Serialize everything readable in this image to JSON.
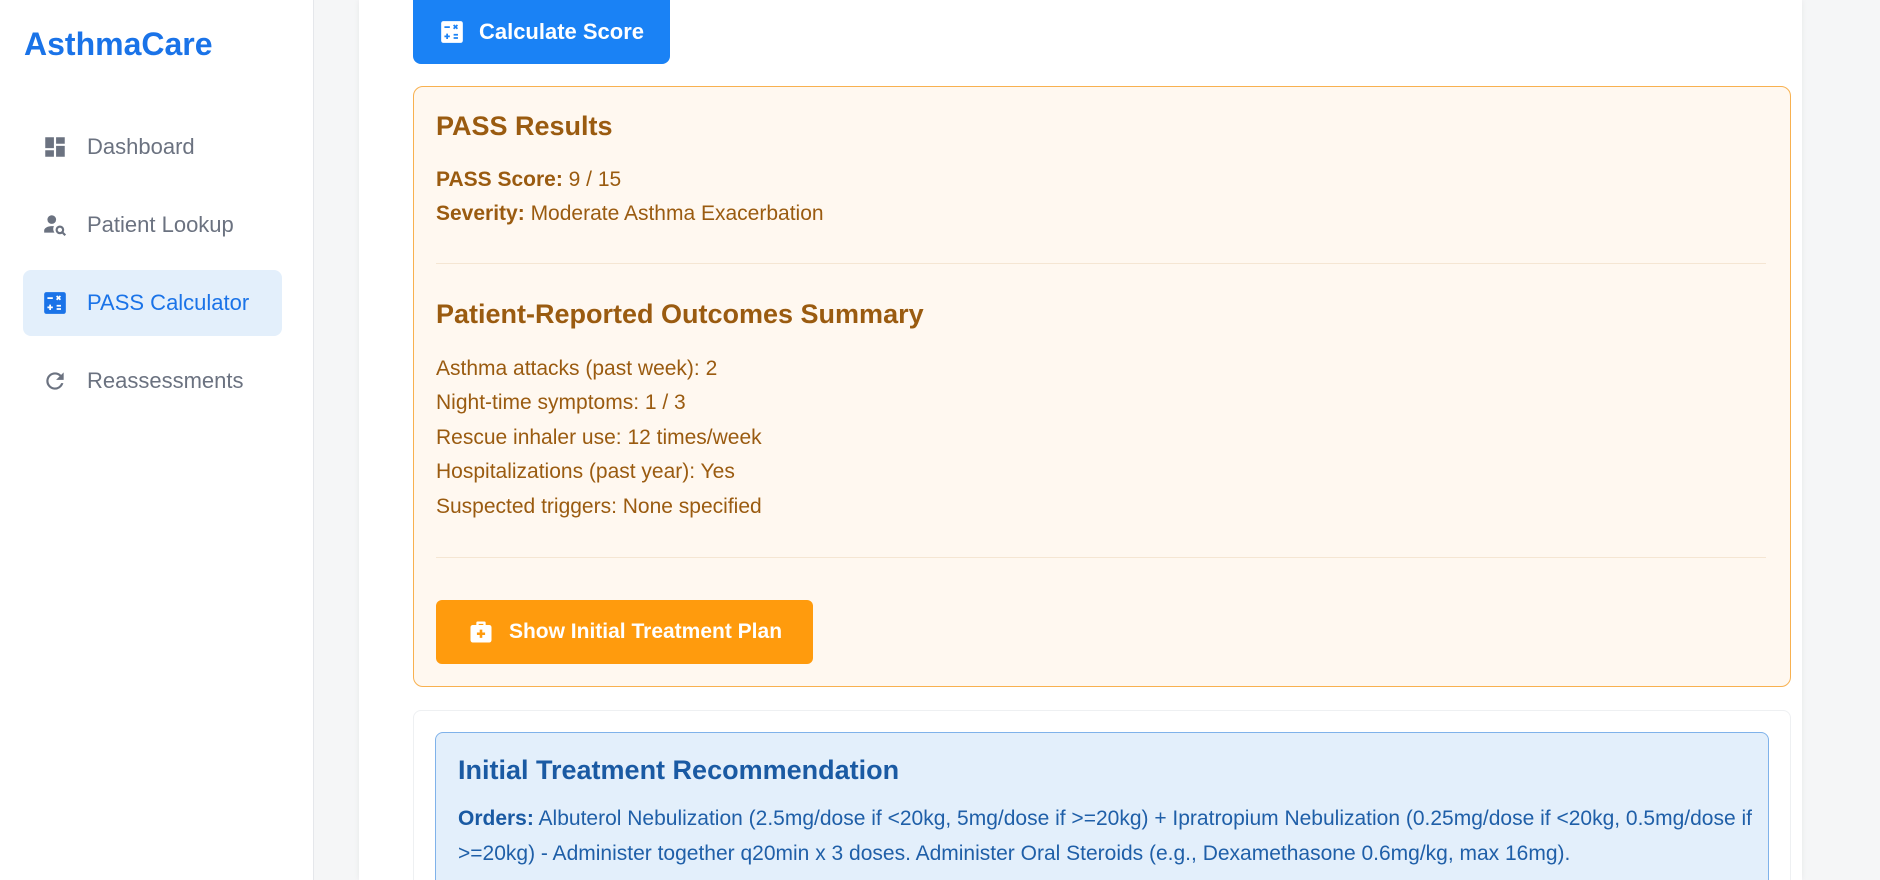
{
  "sidebar": {
    "brand": "AsthmaCare",
    "items": [
      {
        "label": "Dashboard",
        "icon": "dashboard-icon",
        "active": false
      },
      {
        "label": "Patient Lookup",
        "icon": "person-search-icon",
        "active": false
      },
      {
        "label": "PASS Calculator",
        "icon": "calculator-icon",
        "active": true
      },
      {
        "label": "Reassessments",
        "icon": "refresh-icon",
        "active": false
      }
    ]
  },
  "actions": {
    "calculate_label": "Calculate Score",
    "show_plan_label": "Show Initial Treatment Plan"
  },
  "results": {
    "title": "PASS Results",
    "score_label": "PASS Score:",
    "score_value": "9 / 15",
    "severity_label": "Severity:",
    "severity_value": "Moderate Asthma Exacerbation"
  },
  "pro_summary": {
    "title": "Patient-Reported Outcomes Summary",
    "lines": [
      "Asthma attacks (past week): 2",
      "Night-time symptoms: 1 / 3",
      "Rescue inhaler use: 12 times/week",
      "Hospitalizations (past year): Yes",
      "Suspected triggers: None specified"
    ]
  },
  "recommendation": {
    "title": "Initial Treatment Recommendation",
    "orders_label": "Orders:",
    "orders_text": "Albuterol Nebulization (2.5mg/dose if <20kg, 5mg/dose if >=20kg) + Ipratropium Nebulization (0.25mg/dose if <20kg, 0.5mg/dose if >=20kg) - Administer together q20min x 3 doses. Administer Oral Steroids (e.g., Dexamethasone 0.6mg/kg, max 16mg)."
  },
  "colors": {
    "primary": "#1a82f5",
    "warning": "#ff9b0d",
    "warning_text": "#9a5b10",
    "info_text": "#1a5aa3"
  }
}
